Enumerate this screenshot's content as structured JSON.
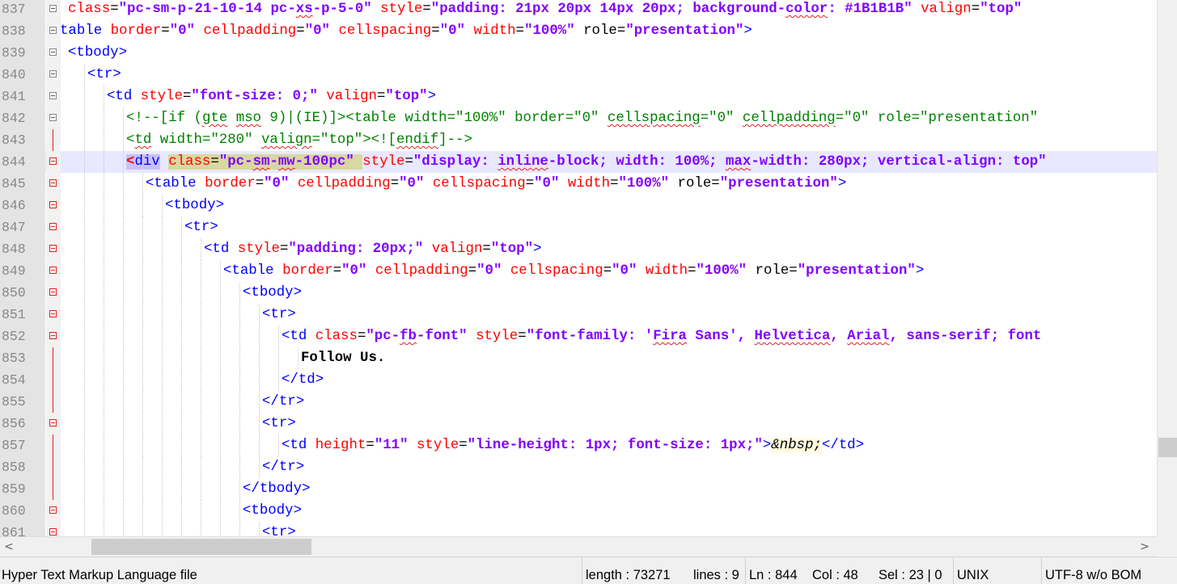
{
  "editor": {
    "current_line": 844,
    "lines": [
      {
        "num": "837",
        "fold": "box",
        "html": "<span class=\"a\">class</span>=<span class=\"v\">\"pc-sm-p-21-10-14 pc-<span class=\"sq\">xs</span>-p-5-0\"</span> <span class=\"a\">style</span>=<span class=\"v\">\"padding: 21px 20px 14px 20px; background-<span class=\"sq\">color</span>: #1B1B1B\"</span> <span class=\"a\">valign</span>=<span class=\"v\">\"top\"</span>"
      },
      {
        "num": "838",
        "fold": "box",
        "html": "<span class=\"t\">table</span> <span class=\"a\">border</span>=<span class=\"v\">\"0\"</span> <span class=\"a\">cellpadding</span>=<span class=\"v\">\"0\"</span> <span class=\"a\">cellspacing</span>=<span class=\"v\">\"0\"</span> <span class=\"a\">width</span>=<span class=\"v\">\"100%\"</span> role=<span class=\"v\">\"presentation\"</span><span class=\"t\">&gt;</span>",
        "indent": -10
      },
      {
        "num": "839",
        "fold": "box",
        "html": "<span class=\"t\">&lt;tbody&gt;</span>"
      },
      {
        "num": "840",
        "fold": "box",
        "html": "<span class=\"t\">&lt;tr&gt;</span>",
        "indent": 24
      },
      {
        "num": "841",
        "fold": "box",
        "html": "<span class=\"t\">&lt;td</span> <span class=\"a\">style</span>=<span class=\"v\">\"font-size: 0;\"</span> <span class=\"a\">valign</span>=<span class=\"v\">\"top\"</span><span class=\"t\">&gt;</span>",
        "indent": 48
      },
      {
        "num": "842",
        "fold": "box",
        "html": "<span class=\"c\">&lt;!--[if (<span class=\"sq\">gte</span> <span class=\"sq\">mso</span> 9)|(IE)]&gt;&lt;table width=\"100%\" border=\"0\" <span class=\"sq\">cellspacing</span>=\"0\" <span class=\"sq\">cellpadding</span>=\"0\" role=\"presentation\"</span>",
        "indent": 72
      },
      {
        "num": "843",
        "fold": "vline",
        "html": "<span class=\"c\">&lt;<span class=\"sq\">td</span> width=\"280\" <span class=\"sq\">valign</span>=\"top\"&gt;&lt;![<span class=\"sq\">endif</span>]--&gt;</span>",
        "indent": 72
      },
      {
        "num": "844",
        "fold": "redbox",
        "current": true,
        "html": "<span class=\"hl\"><span class=\"badtag\">&lt;</span><span class=\"t\">div</span></span> <span class=\"bx\"><span class=\"a\">class</span>=<span class=\"v\">\"pc-<span class=\"sq\">sm</span>-<span class=\"sq\">mw</span>-100pc\"</span> </span><span class=\"a\">style</span>=<span class=\"v\">\"display: <span class=\"sq\">inline</span>-block; width: 100%; <span class=\"sq\">max</span>-width: 280px; vertical-align: top\"</span>",
        "indent": 72
      },
      {
        "num": "845",
        "fold": "redbox",
        "html": "<span class=\"t\">&lt;table</span> <span class=\"a\">border</span>=<span class=\"v\">\"0\"</span> <span class=\"a\">cellpadding</span>=<span class=\"v\">\"0\"</span> <span class=\"a\">cellspacing</span>=<span class=\"v\">\"0\"</span> <span class=\"a\">width</span>=<span class=\"v\">\"100%\"</span> role=<span class=\"v\">\"presentation\"</span><span class=\"t\">&gt;</span>",
        "indent": 96
      },
      {
        "num": "846",
        "fold": "redbox",
        "html": "<span class=\"t\">&lt;tbody&gt;</span>",
        "indent": 120
      },
      {
        "num": "847",
        "fold": "redbox",
        "html": "<span class=\"t\">&lt;tr&gt;</span>",
        "indent": 144
      },
      {
        "num": "848",
        "fold": "redbox",
        "html": "<span class=\"t\">&lt;td</span> <span class=\"a\">style</span>=<span class=\"v\">\"padding: 20px;\"</span> <span class=\"a\">valign</span>=<span class=\"v\">\"top\"</span><span class=\"t\">&gt;</span>",
        "indent": 168
      },
      {
        "num": "849",
        "fold": "redbox",
        "html": "<span class=\"t\">&lt;table</span> <span class=\"a\">border</span>=<span class=\"v\">\"0\"</span> <span class=\"a\">cellpadding</span>=<span class=\"v\">\"0\"</span> <span class=\"a\">cellspacing</span>=<span class=\"v\">\"0\"</span> <span class=\"a\">width</span>=<span class=\"v\">\"100%\"</span> role=<span class=\"v\">\"presentation\"</span><span class=\"t\">&gt;</span>",
        "indent": 192
      },
      {
        "num": "850",
        "fold": "redbox",
        "html": "<span class=\"t\">&lt;tbody&gt;</span>",
        "indent": 216
      },
      {
        "num": "851",
        "fold": "redbox",
        "html": "<span class=\"t\">&lt;tr&gt;</span>",
        "indent": 240
      },
      {
        "num": "852",
        "fold": "redbox",
        "html": "<span class=\"t\">&lt;td</span> <span class=\"a\">class</span>=<span class=\"v\">\"pc-<span class=\"sq\">fb</span>-font\"</span> <span class=\"a\">style</span>=<span class=\"v\">\"font-family: '<span class=\"sq\">Fira</span> Sans', <span class=\"sq\">Helvetica</span>, <span class=\"sq\">Arial</span>, sans-serif; font</span>",
        "indent": 264
      },
      {
        "num": "853",
        "fold": "vline",
        "html": "<span class=\"s\">Follow Us.</span>",
        "indent": 288
      },
      {
        "num": "854",
        "fold": "vline",
        "html": "<span class=\"t\">&lt;/td&gt;</span>",
        "indent": 264
      },
      {
        "num": "855",
        "fold": "vline",
        "html": "<span class=\"t\">&lt;/tr&gt;</span>",
        "indent": 240
      },
      {
        "num": "856",
        "fold": "redbox",
        "html": "<span class=\"t\">&lt;tr&gt;</span>",
        "indent": 240
      },
      {
        "num": "857",
        "fold": "vline",
        "html": "<span class=\"t\">&lt;td</span> <span class=\"a\">height</span>=<span class=\"v\">\"11\"</span> <span class=\"a\">style</span>=<span class=\"v\">\"line-height: 1px; font-size: 1px;\"</span><span class=\"t\">&gt;</span><span class=\"e\">&amp;nbsp;</span><span class=\"t\">&lt;/td&gt;</span>",
        "indent": 264
      },
      {
        "num": "858",
        "fold": "vline",
        "html": "<span class=\"t\">&lt;/tr&gt;</span>",
        "indent": 240
      },
      {
        "num": "859",
        "fold": "vline",
        "html": "<span class=\"t\">&lt;/tbody&gt;</span>",
        "indent": 216
      },
      {
        "num": "860",
        "fold": "redbox",
        "html": "<span class=\"t\">&lt;tbody&gt;</span>",
        "indent": 216
      },
      {
        "num": "861",
        "fold": "redbox",
        "html": "<span class=\"t\">&lt;tr&gt;</span>",
        "indent": 240
      }
    ]
  },
  "scrollbars": {
    "left_arrow": "<",
    "right_arrow": ">"
  },
  "statusbar": {
    "file_type": "Hyper Text Markup Language file",
    "length": "length : 73271",
    "lines": "lines : 9",
    "position": "Ln : 844",
    "column": "Col : 48",
    "selection": "Sel : 23 | 0",
    "eol": "UNIX",
    "encoding": "UTF-8 w/o BOM"
  },
  "colors": {
    "tag": "#0000ff",
    "attribute": "#ff0000",
    "value": "#8000ff",
    "comment": "#008000",
    "current_line": "#e8e8ff"
  }
}
